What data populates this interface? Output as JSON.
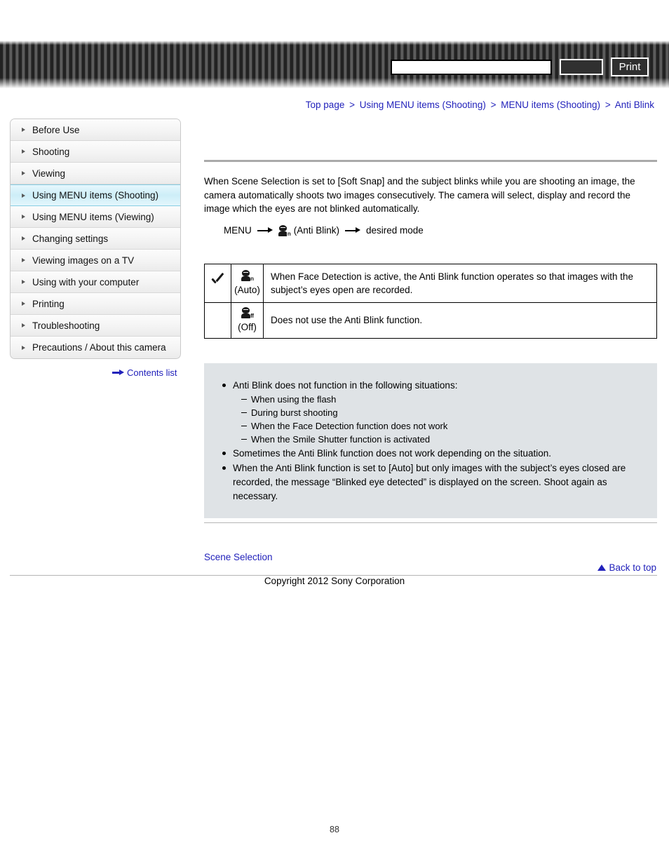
{
  "header": {
    "search": {
      "value": "",
      "placeholder": ""
    },
    "search_button_label": "",
    "print_button_label": "Print"
  },
  "breadcrumb": {
    "separator": ">",
    "items": [
      "Top page",
      "Using MENU items (Shooting)",
      "MENU items (Shooting)",
      "Anti Blink"
    ]
  },
  "sidebar": {
    "items": [
      {
        "label": "Before Use",
        "active": false
      },
      {
        "label": "Shooting",
        "active": false
      },
      {
        "label": "Viewing",
        "active": false
      },
      {
        "label": "Using MENU items (Shooting)",
        "active": true
      },
      {
        "label": "Using MENU items (Viewing)",
        "active": false
      },
      {
        "label": "Changing settings",
        "active": false
      },
      {
        "label": "Viewing images on a TV",
        "active": false
      },
      {
        "label": "Using with your computer",
        "active": false
      },
      {
        "label": "Printing",
        "active": false
      },
      {
        "label": "Troubleshooting",
        "active": false
      },
      {
        "label": "Precautions / About this camera",
        "active": false
      }
    ],
    "contents_link": "Contents list"
  },
  "main": {
    "intro": "When Scene Selection is set to [Soft Snap] and the subject blinks while you are shooting an image, the camera automatically shoots two images consecutively. The camera will select, display and record the image which the eyes are not blinked automatically.",
    "menu_path": {
      "start": "MENU",
      "icon_label": "anti-blink-auto-icon",
      "icon_subscript": "n",
      "middle": "(Anti Blink)",
      "end": "desired mode"
    },
    "options_table": {
      "rows": [
        {
          "checked": true,
          "icon_subscript": "n",
          "name": "(Auto)",
          "description": "When Face Detection is active, the Anti Blink function operates so that images with the subject’s eyes open are recorded."
        },
        {
          "checked": false,
          "icon_subscript": "ff",
          "name": "(Off)",
          "description": "Does not use the Anti Blink function."
        }
      ]
    },
    "notes": [
      {
        "text": "Anti Blink does not function in the following situations:",
        "sub": [
          "When using the flash",
          "During burst shooting",
          "When the Face Detection function does not work",
          "When the Smile Shutter function is activated"
        ]
      },
      {
        "text": "Sometimes the Anti Blink function does not work depending on the situation.",
        "sub": []
      },
      {
        "text": "When the Anti Blink function is set to [Auto] but only images with the subject’s eyes closed are recorded, the message “Blinked eye detected” is displayed on the screen. Shoot again as necessary.",
        "sub": []
      }
    ],
    "related_link": "Scene Selection"
  },
  "footer": {
    "back_to_top": "Back to top",
    "copyright": "Copyright 2012 Sony Corporation",
    "page_number": "88"
  },
  "colors": {
    "link": "#2222bb",
    "sidebar_active": "#cdeef8",
    "notes_background": "#dfe3e6",
    "banner_dark": "#222222"
  }
}
